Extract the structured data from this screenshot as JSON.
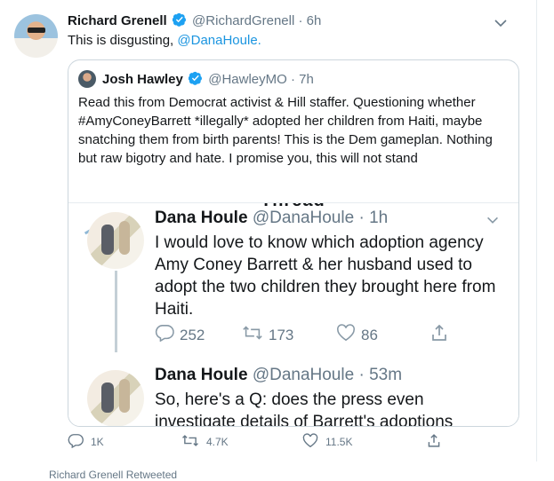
{
  "tweet": {
    "name": "Richard Grenell",
    "handle": "@RichardGrenell",
    "sep": "·",
    "time": "6h",
    "text_prefix": "This is disgusting, ",
    "mention": "@DanaHoule."
  },
  "quote": {
    "name": "Josh Hawley",
    "handle": "@HawleyMO",
    "sep": "·",
    "time": "7h",
    "text": "Read this from Democrat activist & Hill staffer. Questioning whether #AmyConeyBarrett *illegally* adopted her children from Haiti, maybe snatching them from birth parents! This is the Dem gameplan. Nothing but raw bigotry and hate. I promise you, this will not stand",
    "embedded_header_fragment": "Thread"
  },
  "inner_tweets": [
    {
      "name": "Dana Houle",
      "handle": "@DanaHoule",
      "sep": "·",
      "time": "1h",
      "text": "I would love to know which adoption agency Amy Coney Barrett & her husband used to adopt the two children they brought here from Haiti.",
      "replies": "252",
      "retweets": "173",
      "likes": "86"
    },
    {
      "name": "Dana Houle",
      "handle": "@DanaHoule",
      "sep": "·",
      "time": "53m",
      "text": "So, here's a Q: does the press even investigate details of Barrett's adoptions"
    }
  ],
  "actions": {
    "replies": "1K",
    "retweets": "4.7K",
    "likes": "11.5K"
  },
  "footer_fragment": "Richard Grenell Retweeted",
  "colors": {
    "link": "#1b95e0",
    "muted": "#657786",
    "verified": "#1da1f2"
  }
}
